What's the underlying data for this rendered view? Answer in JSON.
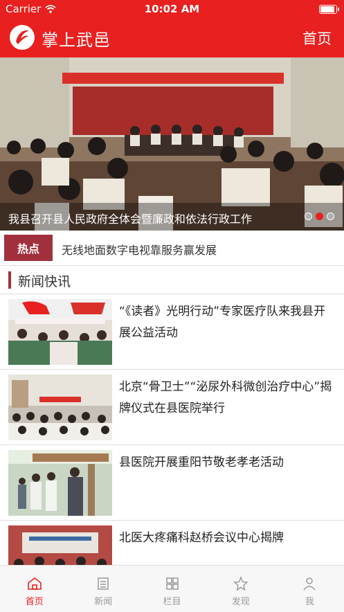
{
  "status_bar": {
    "carrier": "Carrier",
    "time": "10:02 AM",
    "battery_level": 1.0
  },
  "header": {
    "title": "掌上武邑",
    "home_label": "首页"
  },
  "banner": {
    "slide_caption": "我县召开县人民政府全体会暨廉政和依法行政工作",
    "pager": {
      "count": 3,
      "active_index": 1
    }
  },
  "hot": {
    "badge": "热点",
    "headline": "无线地面数字电视靠服务赢发展"
  },
  "section": {
    "title": "新闻快讯"
  },
  "news": [
    {
      "title": "“《读者》光明行动”专家医疗队来我县开展公益活动"
    },
    {
      "title": "北京“骨卫士”“泌尿外科微创治疗中心”揭牌仪式在县医院举行"
    },
    {
      "title": "县医院开展重阳节敬老孝老活动"
    },
    {
      "title": "北医大疼痛科赵桥会议中心揭牌"
    }
  ],
  "tabs": [
    {
      "label": "首页",
      "icon": "home-icon",
      "active": true
    },
    {
      "label": "新闻",
      "icon": "news-icon",
      "active": false
    },
    {
      "label": "栏目",
      "icon": "grid-icon",
      "active": false
    },
    {
      "label": "发现",
      "icon": "discover-icon",
      "active": false
    },
    {
      "label": "我",
      "icon": "person-icon",
      "active": false
    }
  ],
  "colors": {
    "brand_red": "#e8201f",
    "hot_badge": "#a1303c"
  }
}
